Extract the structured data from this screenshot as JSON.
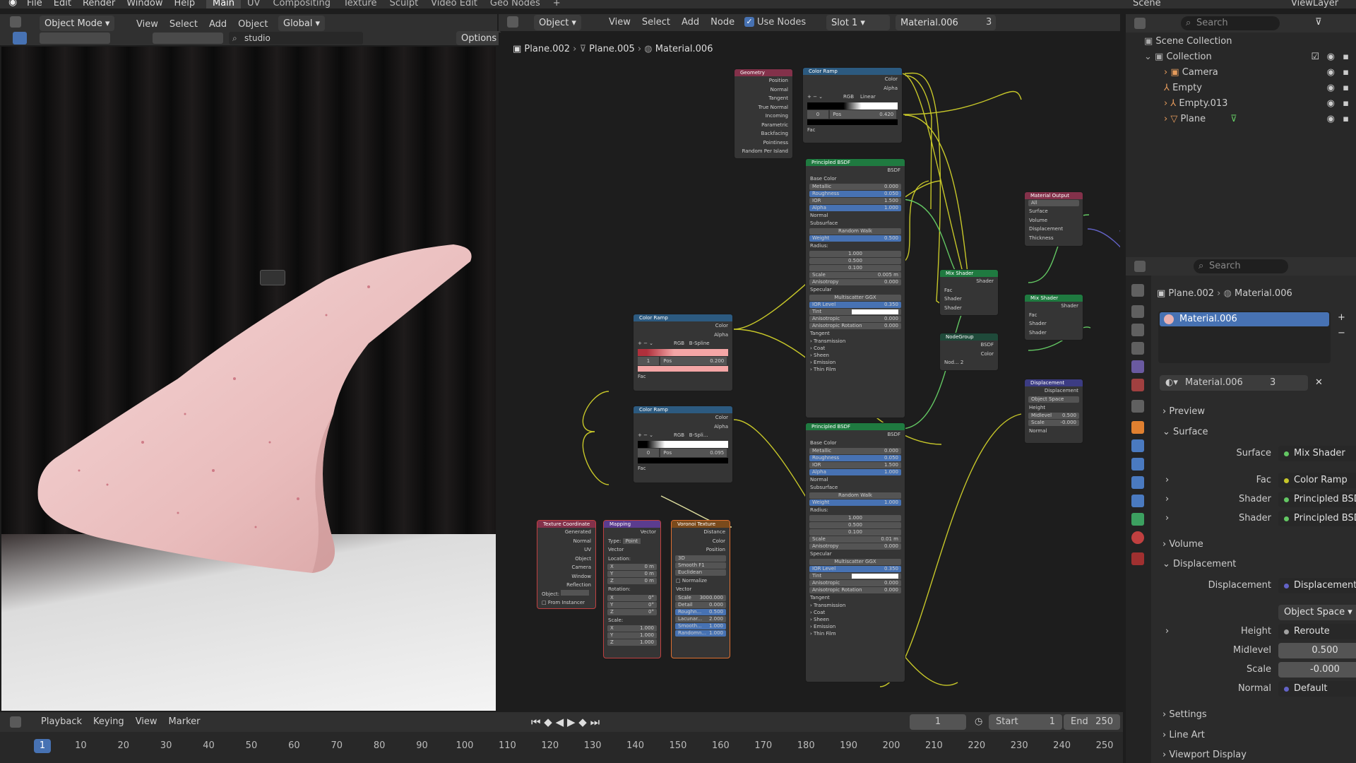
{
  "topbar": {
    "menus": [
      "File",
      "Edit",
      "Render",
      "Window",
      "Help"
    ],
    "workspaces": [
      "Main",
      "UV",
      "Compositing",
      "Texture",
      "Sculpt",
      "Video Edit",
      "Geo Nodes"
    ],
    "scene": "Scene",
    "view_layer": "ViewLayer"
  },
  "viewport": {
    "mode": "Object Mode",
    "menus": [
      "View",
      "Select",
      "Add",
      "Object"
    ],
    "orientation": "Global",
    "shading_search": "studio",
    "options": "Options"
  },
  "node_editor": {
    "type": "Object",
    "menus": [
      "View",
      "Select",
      "Add",
      "Node"
    ],
    "use_nodes": "Use Nodes",
    "slot": "Slot 1",
    "material": "Material.006",
    "users": "3",
    "breadcrumb": [
      "Plane.002",
      "Plane.005",
      "Material.006"
    ]
  },
  "nodes": {
    "geometry": {
      "title": "Geometry",
      "outputs": [
        "Position",
        "Normal",
        "Tangent",
        "True Normal",
        "Incoming",
        "Parametric",
        "Backfacing",
        "Pointiness",
        "Random Per Island"
      ]
    },
    "ramp_top": {
      "title": "Color Ramp",
      "out1": "Color",
      "out2": "Alpha",
      "mode": "RGB",
      "interp": "Linear",
      "idx": "0",
      "pos_label": "Pos",
      "pos": "0.420",
      "fac": "Fac"
    },
    "pbsdf1": {
      "title": "Principled BSDF",
      "out": "BSDF",
      "base": "Base Color",
      "metallic": "Metallic",
      "metallic_v": "0.000",
      "rough": "Roughness",
      "rough_v": "0.050",
      "ior": "IOR",
      "ior_v": "1.500",
      "alpha": "Alpha",
      "alpha_v": "1.000",
      "normal": "Normal",
      "subsurface": "Subsurface",
      "method": "Random Walk",
      "weight": "Weight",
      "weight_v": "0.500",
      "radius": "Radius:",
      "r1": "1.000",
      "r2": "0.500",
      "r3": "0.100",
      "scale": "Scale",
      "scale_v": "0.005 m",
      "aniso": "Anisotropy",
      "aniso_v": "0.000",
      "specular": "Specular",
      "dist": "Multiscatter GGX",
      "ior_level": "IOR Level",
      "ior_level_v": "0.350",
      "tint": "Tint",
      "anisotropic": "Anisotropic",
      "anisotropic_v": "0.000",
      "aniso_rot": "Anisotropic Rotation",
      "aniso_rot_v": "0.000",
      "tangent": "Tangent",
      "panels": [
        "Transmission",
        "Coat",
        "Sheen",
        "Emission",
        "Thin Film"
      ]
    },
    "pbsdf2": {
      "title": "Principled BSDF",
      "out": "BSDF",
      "base": "Base Color",
      "metallic": "Metallic",
      "metallic_v": "0.000",
      "rough": "Roughness",
      "rough_v": "0.050",
      "ior": "IOR",
      "ior_v": "1.500",
      "alpha": "Alpha",
      "alpha_v": "1.000",
      "normal": "Normal",
      "subsurface": "Subsurface",
      "method": "Random Walk",
      "weight": "Weight",
      "weight_v": "1.000",
      "radius": "Radius:",
      "r1": "1.000",
      "r2": "0.500",
      "r3": "0.100",
      "scale": "Scale",
      "scale_v": "0.01 m",
      "aniso": "Anisotropy",
      "aniso_v": "0.000",
      "specular": "Specular",
      "dist": "Multiscatter GGX",
      "ior_level": "IOR Level",
      "ior_level_v": "0.350",
      "tint": "Tint",
      "anisotropic": "Anisotropic",
      "anisotropic_v": "0.000",
      "aniso_rot": "Anisotropic Rotation",
      "aniso_rot_v": "0.000",
      "tangent": "Tangent",
      "panels": [
        "Transmission",
        "Coat",
        "Sheen",
        "Emission",
        "Thin Film"
      ]
    },
    "ramp_mid": {
      "title": "Color Ramp",
      "out1": "Color",
      "out2": "Alpha",
      "mode": "RGB",
      "interp": "B-Spline",
      "idx": "1",
      "pos_label": "Pos",
      "pos": "0.200",
      "fac": "Fac"
    },
    "ramp_low": {
      "title": "Color Ramp",
      "out1": "Color",
      "out2": "Alpha",
      "mode": "RGB",
      "interp": "B-Spli...",
      "idx": "0",
      "pos_label": "Pos",
      "pos": "0.095",
      "fac": "Fac"
    },
    "texcoord": {
      "title": "Texture Coordinate",
      "outputs": [
        "Generated",
        "Normal",
        "UV",
        "Object",
        "Camera",
        "Window",
        "Reflection"
      ],
      "object": "Object:",
      "from_instancer": "From Instancer"
    },
    "mapping": {
      "title": "Mapping",
      "vector": "Vector",
      "type_label": "Type:",
      "type": "Point",
      "vec_in": "Vector",
      "location": "Location:",
      "loc": [
        "0 m",
        "0 m",
        "0 m"
      ],
      "rotation": "Rotation:",
      "rot": [
        "0°",
        "0°",
        "0°"
      ],
      "scale": "Scale:",
      "scl": [
        "1.000",
        "1.000",
        "1.000"
      ],
      "axes": [
        "X",
        "Y",
        "Z"
      ]
    },
    "voronoi": {
      "title": "Voronoi Texture",
      "outputs": [
        "Distance",
        "Color",
        "Position"
      ],
      "dim": "3D",
      "feature": "Smooth F1",
      "metric": "Euclidean",
      "normalize": "Normalize",
      "vector": "Vector",
      "scale": "Scale",
      "scale_v": "3000.000",
      "detail": "Detail",
      "detail_v": "0.000",
      "rough": "Roughn...",
      "rough_v": "0.500",
      "lacun": "Lacunar...",
      "lacun_v": "2.000",
      "smooth": "Smooth...",
      "smooth_v": "1.000",
      "random": "Randomn...",
      "random_v": "1.000"
    },
    "mix1": {
      "title": "Mix Shader",
      "out": "Shader",
      "inputs": [
        "Fac",
        "Shader",
        "Shader"
      ]
    },
    "nodegroup": {
      "title": "NodeGroup",
      "out1": "BSDF",
      "out2": "Color",
      "name": "Nod...",
      "users": "2"
    },
    "mix2": {
      "title": "Mix Shader",
      "out": "Shader",
      "inputs": [
        "Fac",
        "Shader",
        "Shader"
      ]
    },
    "matout": {
      "title": "Material Output",
      "target": "All",
      "inputs": [
        "Surface",
        "Volume",
        "Displacement",
        "Thickness"
      ]
    },
    "disp": {
      "title": "Displacement",
      "out": "Displacement",
      "space": "Object Space",
      "height": "Height",
      "midlevel": "Midlevel",
      "midlevel_v": "0.500",
      "scale": "Scale",
      "scale_v": "-0.000",
      "normal": "Normal"
    }
  },
  "timeline": {
    "menus": [
      "Playback",
      "Keying",
      "View",
      "Marker"
    ],
    "current": "1",
    "start_label": "Start",
    "start": "1",
    "end_label": "End",
    "end": "250",
    "ticks": [
      "1",
      "10",
      "20",
      "30",
      "40",
      "50",
      "60",
      "70",
      "80",
      "90",
      "100",
      "110",
      "120",
      "130",
      "140",
      "150",
      "160",
      "170",
      "180",
      "190",
      "200",
      "210",
      "220",
      "230",
      "240",
      "250"
    ]
  },
  "outliner": {
    "search": "Search",
    "root": "Scene Collection",
    "collection": "Collection",
    "items": [
      "Camera",
      "Empty",
      "Empty.013",
      "Plane"
    ]
  },
  "properties": {
    "search": "Search",
    "breadcrumb": [
      "Plane.002",
      "Material.006"
    ],
    "slot": "Material.006",
    "material": "Material.006",
    "users": "3",
    "sections": {
      "preview": "Preview",
      "surface": "Surface",
      "volume": "Volume",
      "displacement": "Displacement",
      "settings": "Settings",
      "line_art": "Line Art",
      "viewport_display": "Viewport Display"
    },
    "surface_label": "Surface",
    "surface_value": "Mix Shader",
    "fac_label": "Fac",
    "fac_value": "Color Ramp",
    "shader1_label": "Shader",
    "shader1_value": "Principled BSDF",
    "shader2_label": "Shader",
    "shader2_value": "Principled BSDF",
    "disp_label": "Displacement",
    "disp_value": "Displacement",
    "space": "Object Space",
    "height_label": "Height",
    "height_value": "Reroute",
    "midlevel_label": "Midlevel",
    "midlevel_value": "0.500",
    "scale_label": "Scale",
    "scale_value": "-0.000",
    "normal_label": "Normal",
    "normal_value": "Default"
  }
}
